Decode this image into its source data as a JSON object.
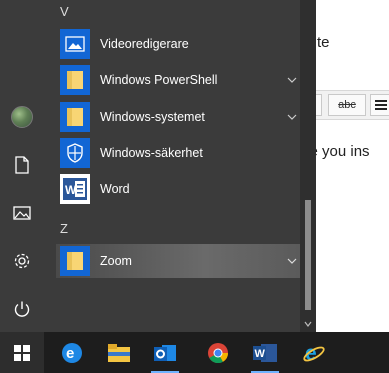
{
  "document": {
    "line1": "te",
    "line2": "ve you ins",
    "toolbar_b2": "abc"
  },
  "startmenu": {
    "sections": [
      {
        "letter": "V"
      },
      {
        "letter": "Z"
      }
    ],
    "apps": [
      {
        "label": "Videoredigerare",
        "icon": "video-editor-icon",
        "expandable": false
      },
      {
        "label": "Windows PowerShell",
        "icon": "folder-icon",
        "expandable": true
      },
      {
        "label": "Windows-systemet",
        "icon": "folder-icon",
        "expandable": true
      },
      {
        "label": "Windows-säkerhet",
        "icon": "shield-icon",
        "expandable": false
      },
      {
        "label": "Word",
        "icon": "word-icon",
        "expandable": false
      },
      {
        "label": "Zoom",
        "icon": "folder-icon",
        "expandable": true,
        "highlighted": true
      }
    ],
    "rail": [
      "user-avatar",
      "documents-icon",
      "pictures-icon",
      "settings-icon",
      "power-icon"
    ]
  },
  "taskbar": {
    "items": [
      "start-button",
      "edge-icon",
      "file-explorer-icon",
      "outlook-icon",
      "chrome-icon",
      "word-icon",
      "internet-explorer-icon"
    ],
    "accent": "#6fb3ff"
  }
}
